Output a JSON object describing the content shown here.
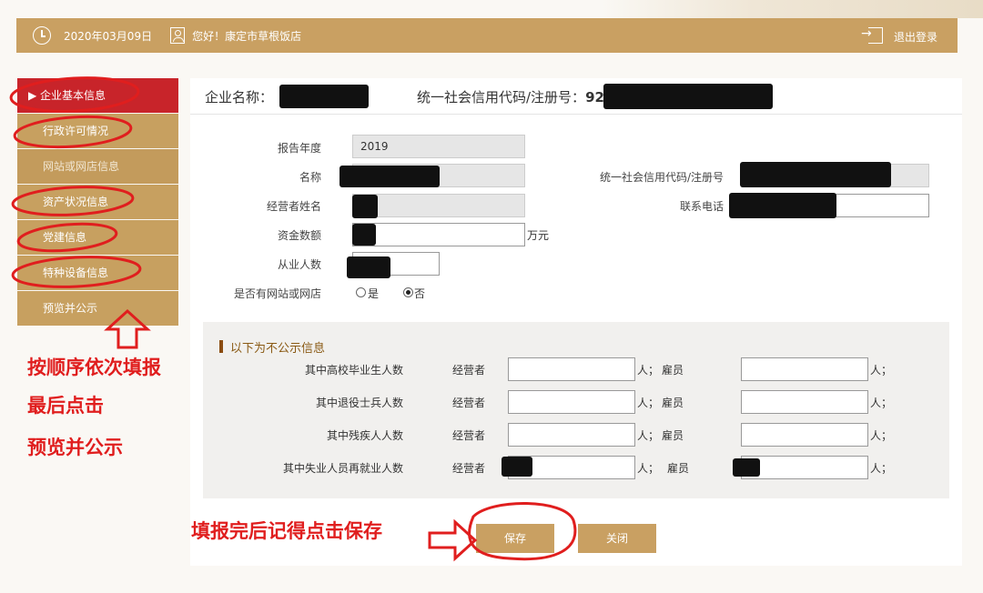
{
  "header": {
    "date": "2020年03月09日",
    "greeting": "您好！康定市草根饭店",
    "logout": "退出登录"
  },
  "sidebar": {
    "items": [
      {
        "label": "▶ 企业基本信息",
        "active": true
      },
      {
        "label": "行政许可情况"
      },
      {
        "label": "网站或网店信息"
      },
      {
        "label": "资产状况信息"
      },
      {
        "label": "党建信息"
      },
      {
        "label": "特种设备信息"
      },
      {
        "label": "预览并公示"
      }
    ]
  },
  "info": {
    "company_label": "企业名称：",
    "credit_label": "统一社会信用代码/注册号：",
    "credit_prefix": "925"
  },
  "form": {
    "report_year_label": "报告年度",
    "report_year": "2019",
    "name_label": "名称",
    "credit_code_label": "统一社会信用代码/注册号",
    "operator_label": "经营者姓名",
    "phone_label": "联系电话",
    "capital_label": "资金数额",
    "capital_unit": "万元",
    "employees_label": "从业人数",
    "has_website_label": "是否有网站或网店",
    "yes": "是",
    "no": "否",
    "has_website_value": "否"
  },
  "private_section": {
    "title": "以下为不公示信息",
    "operator": "经营者",
    "employee": "雇员",
    "unit_person": "人；",
    "rows": [
      {
        "label": "其中高校毕业生人数"
      },
      {
        "label": "其中退役士兵人数"
      },
      {
        "label": "其中残疾人人数"
      },
      {
        "label": "其中失业人员再就业人数"
      }
    ]
  },
  "buttons": {
    "save": "保存",
    "close": "关闭"
  },
  "annotations": {
    "line1": "按顺序依次填报",
    "line2": "最后点击",
    "line3": "预览并公示",
    "save_hint": "填报完后记得点击保存"
  },
  "colors": {
    "gold": "#c9a062",
    "active": "#c8242a",
    "annotation": "#e01e1e"
  }
}
